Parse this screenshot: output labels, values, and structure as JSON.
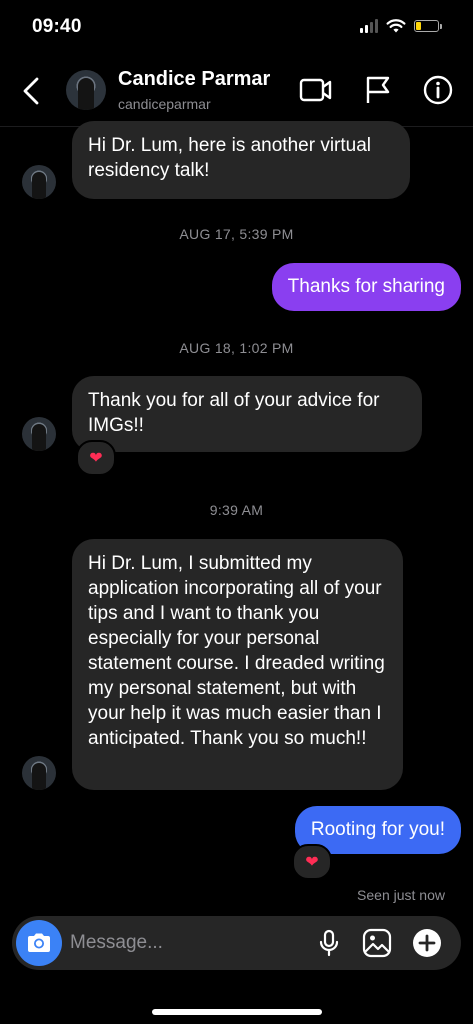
{
  "status_bar": {
    "time": "09:40"
  },
  "header": {
    "name": "Candice Parmar",
    "handle": "candiceparmar",
    "icons": [
      "back-chevron-icon",
      "video-call-icon",
      "report-flag-icon",
      "info-icon"
    ]
  },
  "messages": [
    {
      "type": "received",
      "text": "Hi Dr. Lum, here is another virtual residency talk!"
    },
    {
      "type": "timestamp",
      "text": "AUG 17, 5:39 PM"
    },
    {
      "type": "sent",
      "text": "Thanks for sharing"
    },
    {
      "type": "timestamp",
      "text": "AUG 18, 1:02 PM"
    },
    {
      "type": "received",
      "text": "Thank you for all of your advice for IMGs!!",
      "reaction": "❤"
    },
    {
      "type": "timestamp",
      "text": "9:39 AM"
    },
    {
      "type": "received",
      "text": "Hi Dr. Lum, I submitted my application incorporating all of your tips and I want to thank you especially for your personal statement course. I dreaded writing my personal statement, but with your help it was much easier than I anticipated. Thank you so much!!"
    },
    {
      "type": "sent",
      "text": "Rooting for you!",
      "reaction": "❤"
    }
  ],
  "seen_status": "Seen just now",
  "composer": {
    "placeholder": "Message...",
    "icons": [
      "camera-icon",
      "microphone-icon",
      "gallery-icon",
      "add-icon"
    ]
  },
  "colors": {
    "background": "#000000",
    "received_bubble": "#262626",
    "sent_bubble_1": "#8a3ff0",
    "sent_bubble_2": "#3c6af4",
    "camera_button": "#3b82f6",
    "reaction_heart": "#ff2d55"
  }
}
